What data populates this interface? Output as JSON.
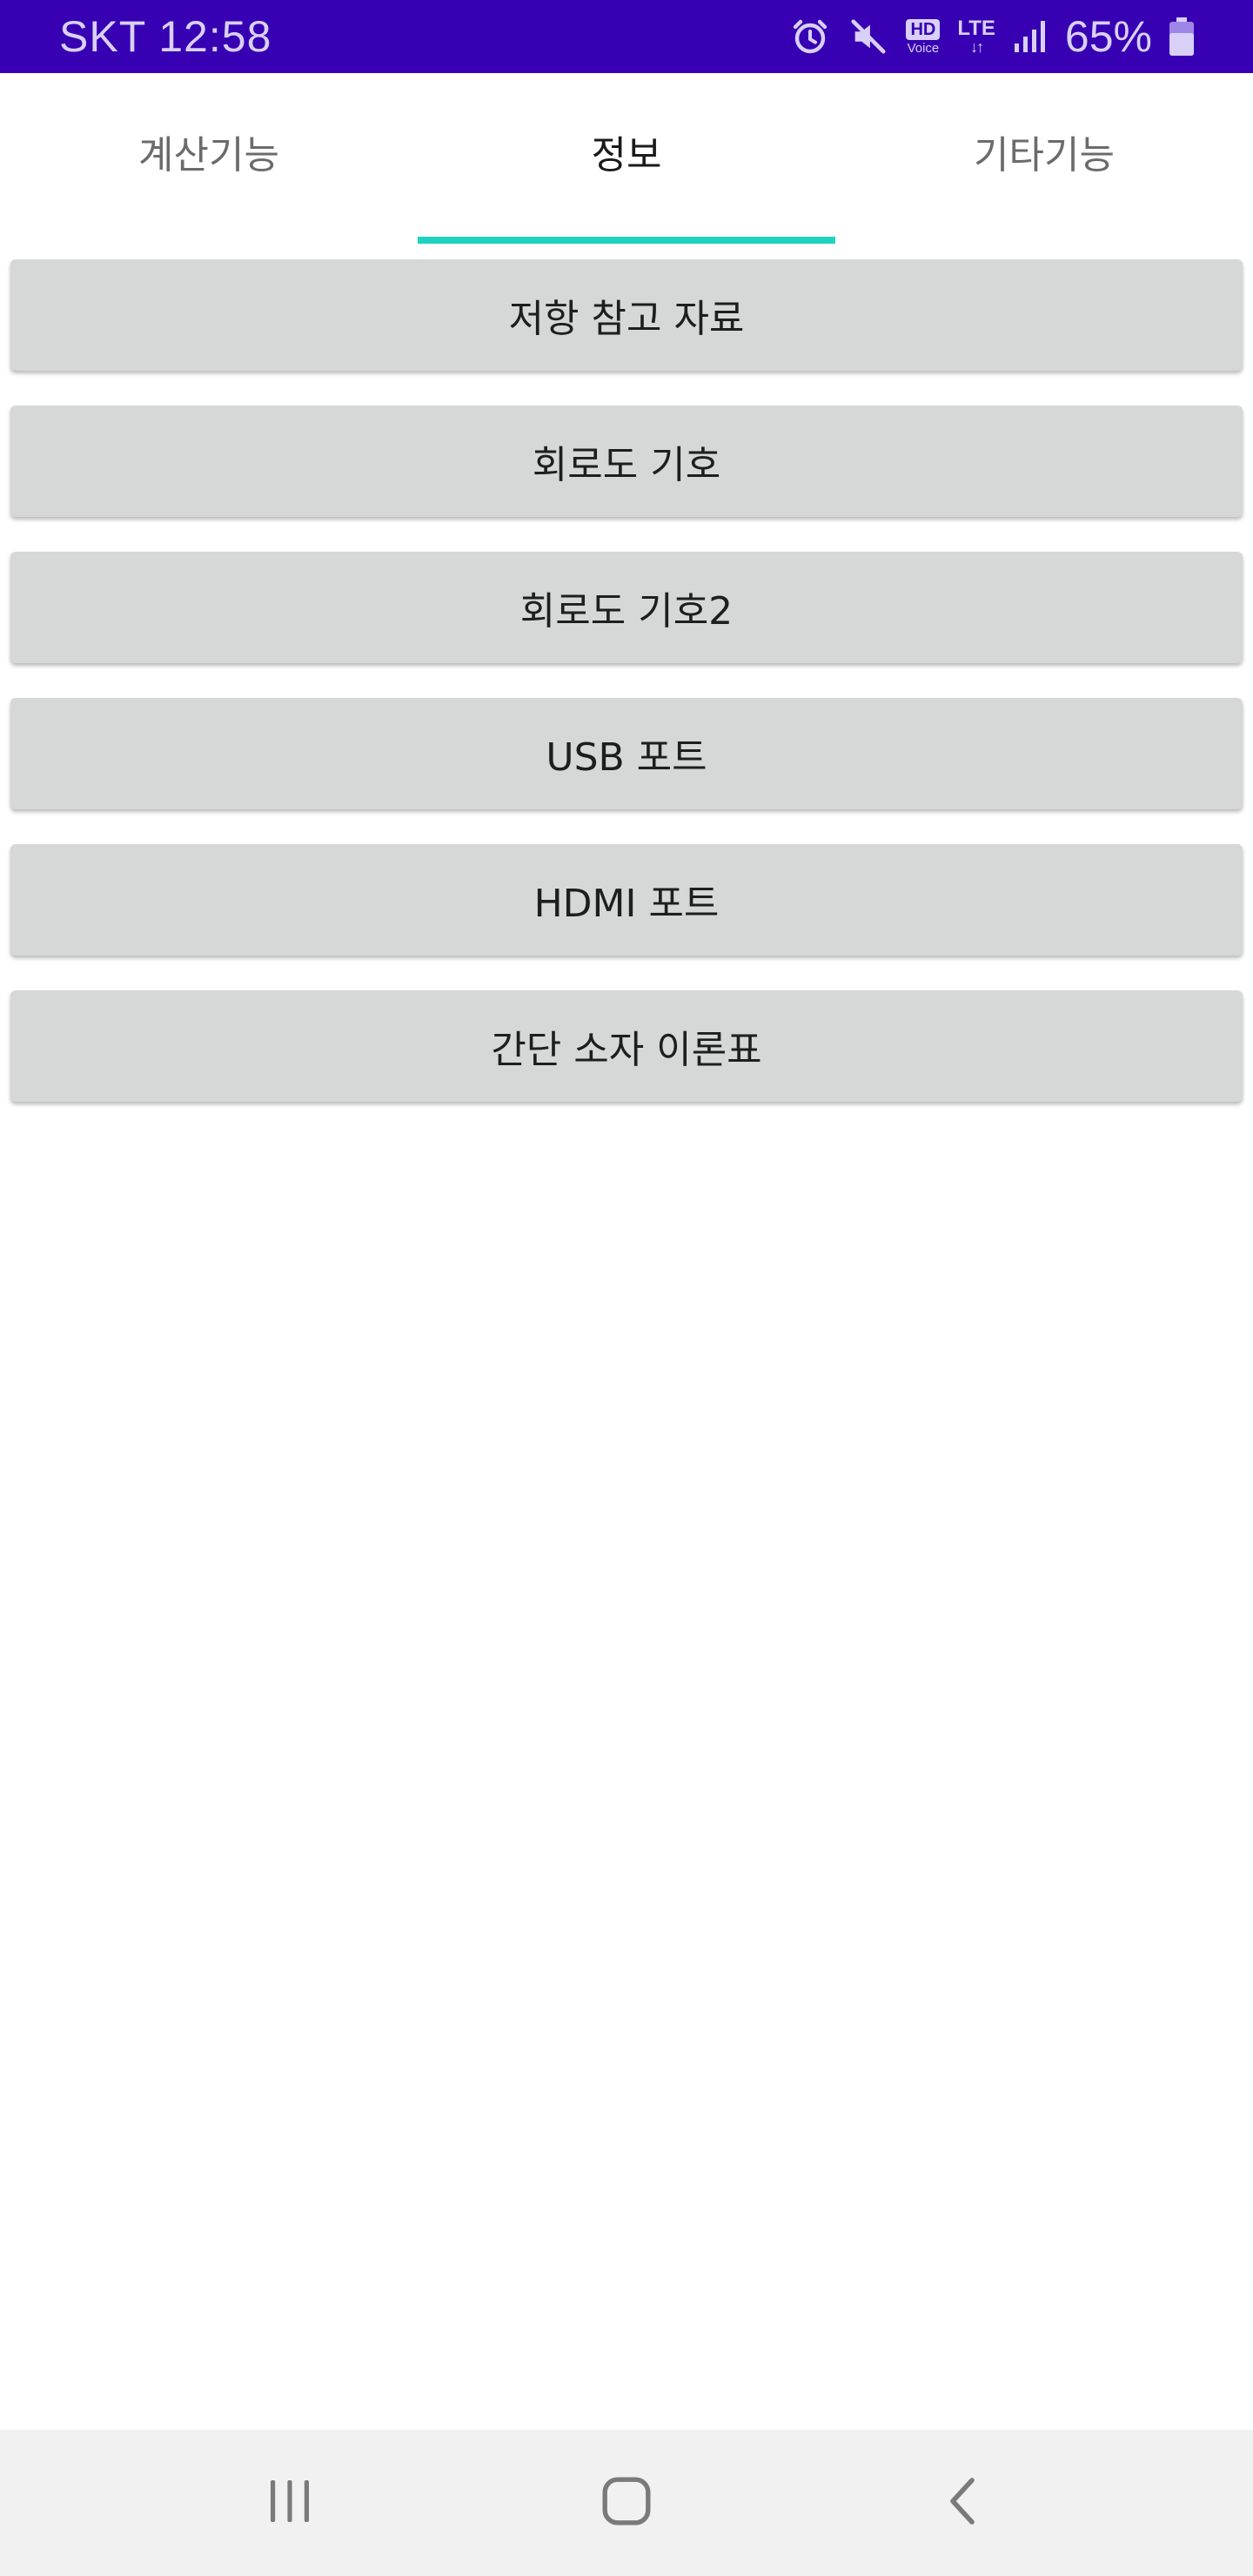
{
  "status_bar": {
    "carrier": "SKT",
    "time": "12:58",
    "hd_label": "HD",
    "voice_label": "Voice",
    "network_type": "LTE",
    "network_arrows": "↓↑",
    "battery_percent": "65%",
    "icons": [
      "alarm-icon",
      "mute-icon",
      "hd-voice-icon",
      "lte-icon",
      "signal-icon",
      "battery-icon"
    ],
    "color": "#3700b3"
  },
  "tabs": [
    {
      "label": "계산기능",
      "active": false
    },
    {
      "label": "정보",
      "active": true
    },
    {
      "label": "기타기능",
      "active": false
    }
  ],
  "tab_indicator_color": "#1dd3c0",
  "buttons": [
    {
      "label": "저항 참고 자료"
    },
    {
      "label": "회로도 기호"
    },
    {
      "label": "회로도 기호2"
    },
    {
      "label": "USB 포트"
    },
    {
      "label": "HDMI 포트"
    },
    {
      "label": "간단 소자 이론표"
    }
  ],
  "button_color": "#d6d7d7",
  "nav_bar": {
    "icons": [
      "recent-apps-icon",
      "home-icon",
      "back-icon"
    ]
  }
}
